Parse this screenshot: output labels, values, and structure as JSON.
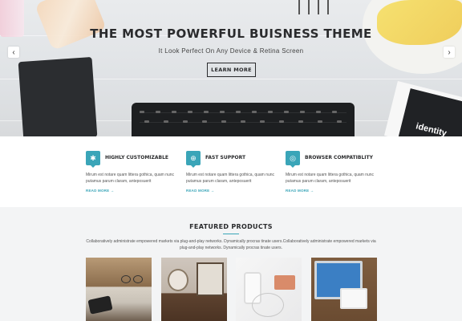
{
  "hero": {
    "title": "THE MOST POWERFUL BUISNESS THEME",
    "subtitle": "It Look Perfect On Any Device & Retina Screen",
    "button_label": "LEARN MORE",
    "prev_arrow": "‹",
    "next_arrow": "›",
    "prev_icon": "chevron-left-icon",
    "next_icon": "chevron-right-icon",
    "card_text": "identity"
  },
  "features": [
    {
      "icon": "gear-icon",
      "icon_glyph": "✱",
      "title": "HIGHLY CUSTOMIZABLE",
      "description": "Mirum est notare quam littera gothica, quam nunc putamus parum claram, anteposuerit",
      "link": "READ MORE →"
    },
    {
      "icon": "globe-icon",
      "icon_glyph": "⊕",
      "title": "FAST SUPPORT",
      "description": "Mirum est notare quam littera gothica, quam nunc putamus parum claram, anteposuerit",
      "link": "READ MORE →"
    },
    {
      "icon": "compass-icon",
      "icon_glyph": "◎",
      "title": "BROWSER COMPATIBLITY",
      "description": "Mirum est notare quam littera gothica, quam nunc putamus parum claram, anteposuerit",
      "link": "READ MORE →"
    }
  ],
  "products": {
    "title": "FEATURED PRODUCTS",
    "description": "Collaboratively administrate empowered markets via plug-and-play networks. Dynamically procras tinate users.Collaboratively administrate empowered markets via plug-and-play networks. Dynamically procras tinate users."
  },
  "colors": {
    "accent": "#3aa5b8",
    "dark_text": "#2a2b2d",
    "section_bg": "#f3f4f5"
  }
}
